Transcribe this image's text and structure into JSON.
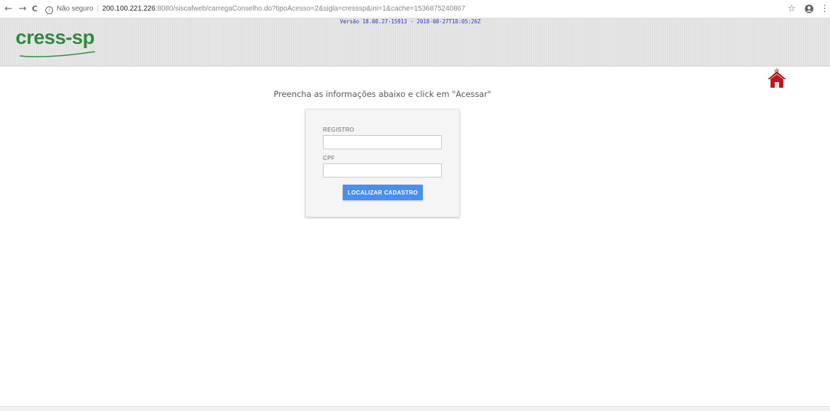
{
  "browser": {
    "security_label": "Não seguro",
    "url_host": "200.100.221.226",
    "url_path": ":8080/siscafweb/carregaConselho.do?tipoAcesso=2&sigla=cresssp&ini=1&cache=1536875240867",
    "back_icon": "←",
    "forward_icon": "→",
    "reload_icon": "C",
    "star_icon": "☆",
    "account_icon": "●",
    "menu_icon": "⋮"
  },
  "header": {
    "logo_text": "CRESS-SP",
    "version": "Versão 18.08.27-15913 - 2018-08-27T18:05:26Z"
  },
  "colors": {
    "logo_green": "#2f8a3a",
    "version_blue": "#2a34c9",
    "button_blue": "#4a8ef0",
    "home_red": "#c0151a"
  },
  "main": {
    "prompt": "Preencha as informações abaixo e click em \"Acessar\"",
    "form": {
      "registro_label": "REGISTRO",
      "registro_value": "",
      "cpf_label": "CPF",
      "cpf_value": "",
      "submit_label": "LOCALIZAR CADASTRO"
    }
  }
}
